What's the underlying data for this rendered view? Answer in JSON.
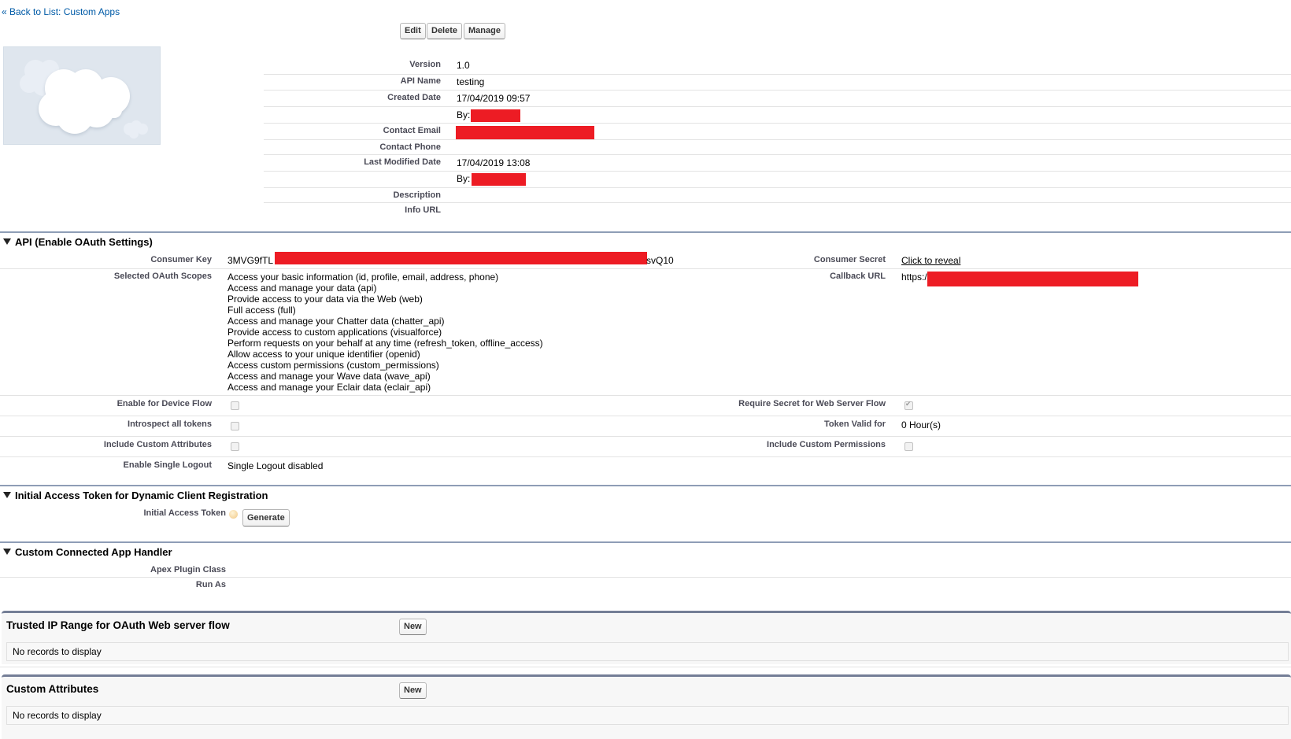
{
  "nav": {
    "back_link": "« Back to List: Custom Apps"
  },
  "toolbar": {
    "edit": "Edit",
    "delete": "Delete",
    "manage": "Manage"
  },
  "logo": {
    "icon": "cloud-placeholder-icon"
  },
  "details": {
    "rows": [
      {
        "label": "Version",
        "value": "1.0"
      },
      {
        "label": "API Name",
        "value": "testing"
      },
      {
        "label": "Created Date",
        "value": "17/04/2019 09:57"
      },
      {
        "label": "",
        "value": "By:",
        "redacted": true
      },
      {
        "label": "Contact Email",
        "value": "",
        "redacted": true
      },
      {
        "label": "Contact Phone",
        "value": ""
      },
      {
        "label": "Last Modified Date",
        "value": "17/04/2019 13:08"
      },
      {
        "label": "",
        "value": "By:",
        "redacted": true
      },
      {
        "label": "Description",
        "value": ""
      },
      {
        "label": "Info URL",
        "value": ""
      }
    ]
  },
  "api_section": {
    "title": "API (Enable OAuth Settings)",
    "consumer_key_label": "Consumer Key",
    "consumer_key_prefix": "3MVG9fTL",
    "consumer_key_suffix": "svQ10",
    "consumer_secret_label": "Consumer Secret",
    "consumer_secret_link": "Click to reveal",
    "scopes_label": "Selected OAuth Scopes",
    "scopes": [
      "Access your basic information (id, profile, email, address, phone)",
      "Access and manage your data (api)",
      "Provide access to your data via the Web (web)",
      "Full access (full)",
      "Access and manage your Chatter data (chatter_api)",
      "Provide access to custom applications (visualforce)",
      "Perform requests on your behalf at any time (refresh_token, offline_access)",
      "Allow access to your unique identifier (openid)",
      "Access custom permissions (custom_permissions)",
      "Access and manage your Wave data (wave_api)",
      "Access and manage your Eclair data (eclair_api)"
    ],
    "callback_label": "Callback URL",
    "callback_prefix": "https:/",
    "device_flow_label": "Enable for Device Flow",
    "device_flow_checked": false,
    "require_secret_label": "Require Secret for Web Server Flow",
    "require_secret_checked": true,
    "introspect_label": "Introspect all tokens",
    "introspect_checked": false,
    "token_valid_label": "Token Valid for",
    "token_valid_value": "0 Hour(s)",
    "custom_attr_label": "Include Custom Attributes",
    "custom_attr_checked": false,
    "custom_perm_label": "Include Custom Permissions",
    "custom_perm_checked": false,
    "single_logout_label": "Enable Single Logout",
    "single_logout_value": "Single Logout disabled"
  },
  "initial_token_section": {
    "title": "Initial Access Token for Dynamic Client Registration",
    "label": "Initial Access Token",
    "generate": "Generate"
  },
  "handler_section": {
    "title": "Custom Connected App Handler",
    "apex_label": "Apex Plugin Class",
    "run_as_label": "Run As"
  },
  "trusted_ip": {
    "title": "Trusted IP Range for OAuth Web server flow",
    "new": "New",
    "empty": "No records to display"
  },
  "custom_attributes": {
    "title": "Custom Attributes",
    "new": "New",
    "empty": "No records to display"
  },
  "colors": {
    "redaction": "#ed1c24",
    "section_rule": "#8e9db6",
    "link": "#015ba7"
  }
}
